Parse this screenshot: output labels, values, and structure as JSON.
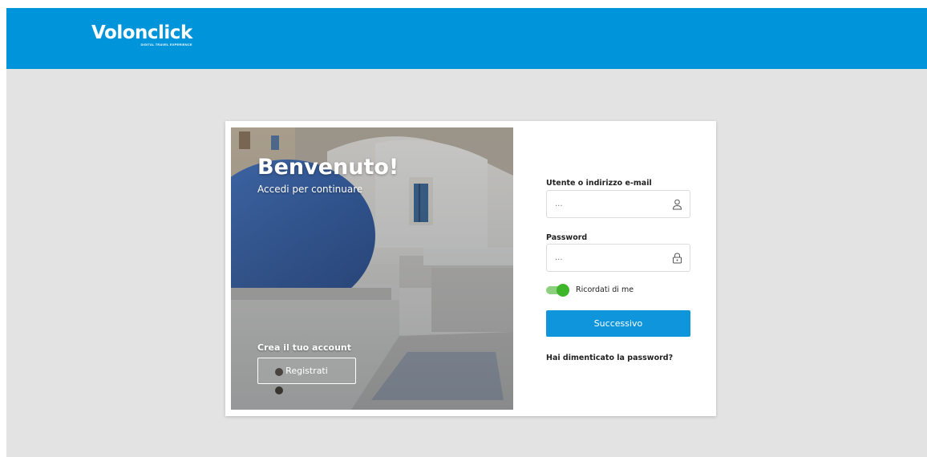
{
  "brand": {
    "name": "Volonclick",
    "tagline": "DIGITAL TRAVEL EXPERIENCE",
    "color": "#0095db"
  },
  "welcome": {
    "title": "Benvenuto!",
    "subtitle": "Accedi per continuare",
    "create_account_label": "Crea il tuo account",
    "register_button": "Registrati"
  },
  "form": {
    "username_label": "Utente o indirizzo e-mail",
    "username_placeholder": "...",
    "username_icon": "user-icon",
    "password_label": "Password",
    "password_placeholder": "...",
    "password_icon": "lock-icon",
    "remember_me_label": "Ricordati di me",
    "remember_me_on": true,
    "submit_button": "Successivo",
    "forgot_password_link": "Hai dimenticato la password?"
  },
  "colors": {
    "accent": "#0f95db",
    "toggle_on": "#3fb52a",
    "page_background": "#e3e3e3"
  }
}
